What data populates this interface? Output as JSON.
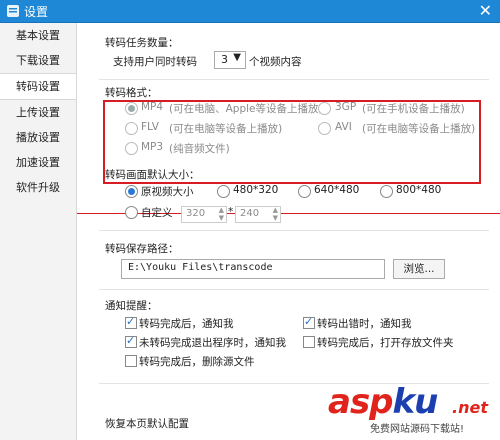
{
  "window": {
    "title": "设置",
    "close_glyph": "✕"
  },
  "sidebar": {
    "items": [
      {
        "label": "基本设置"
      },
      {
        "label": "下载设置"
      },
      {
        "label": "转码设置"
      },
      {
        "label": "上传设置"
      },
      {
        "label": "播放设置"
      },
      {
        "label": "加速设置"
      },
      {
        "label": "软件升级"
      }
    ],
    "active_index": 2
  },
  "tasks": {
    "label": "转码任务数量：",
    "prefix": "支持用户同时转码",
    "value": "3",
    "suffix": "个视频内容"
  },
  "format": {
    "label": "转码格式：",
    "options": [
      {
        "name": "MP4",
        "desc": "(可在电脑、Apple等设备上播放)",
        "checked": true
      },
      {
        "name": "3GP",
        "desc": "(可在手机设备上播放)",
        "checked": false
      },
      {
        "name": "FLV",
        "desc": "(可在电脑等设备上播放)",
        "checked": false
      },
      {
        "name": "AVI",
        "desc": "(可在电脑等设备上播放)",
        "checked": false
      },
      {
        "name": "MP3",
        "desc": "(纯音频文件)",
        "checked": false
      }
    ]
  },
  "size": {
    "label": "转码画面默认大小：",
    "options": [
      {
        "label": "原视频大小",
        "checked": true
      },
      {
        "label": "480*320",
        "checked": false
      },
      {
        "label": "640*480",
        "checked": false
      },
      {
        "label": "800*480",
        "checked": false
      }
    ],
    "custom_label": "自定义",
    "width": "320",
    "height": "240",
    "times": "*"
  },
  "path": {
    "label": "转码保存路径：",
    "value": "E:\\Youku Files\\transcode",
    "browse": "浏览..."
  },
  "notify": {
    "label": "通知提醒：",
    "items": [
      {
        "label": "转码完成后，通知我",
        "checked": true
      },
      {
        "label": "转码出错时，通知我",
        "checked": true
      },
      {
        "label": "未转码完成退出程序时，通知我",
        "checked": true
      },
      {
        "label": "转码完成后，打开存放文件夹",
        "checked": false
      },
      {
        "label": "转码完成后，删除源文件",
        "checked": false
      }
    ]
  },
  "restore_label": "恢复本页默认配置",
  "watermark": {
    "asp": "asp",
    "ku": "ku",
    "net": ".net",
    "sub": "免费网站源码下载站!"
  },
  "colors": {
    "titlebar": "#1e88d6",
    "highlight": "#d71c24",
    "accent": "#2a7ad4"
  }
}
